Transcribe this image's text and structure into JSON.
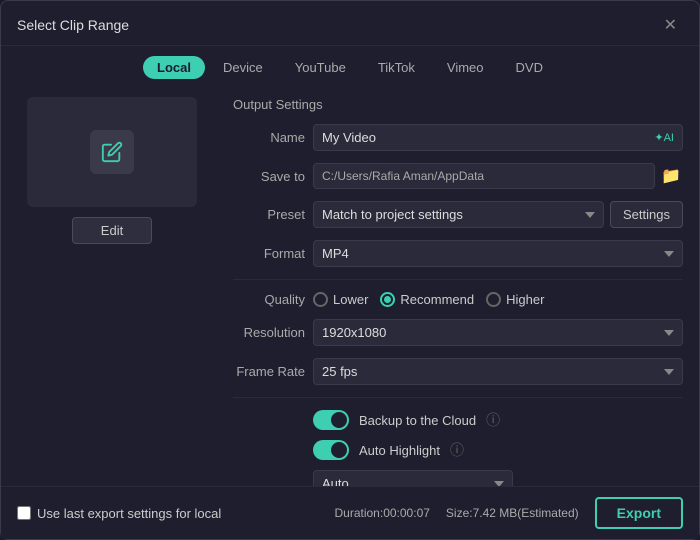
{
  "dialog": {
    "title": "Select Clip Range",
    "close_label": "✕"
  },
  "tabs": [
    {
      "id": "local",
      "label": "Local",
      "active": true
    },
    {
      "id": "device",
      "label": "Device",
      "active": false
    },
    {
      "id": "youtube",
      "label": "YouTube",
      "active": false
    },
    {
      "id": "tiktok",
      "label": "TikTok",
      "active": false
    },
    {
      "id": "vimeo",
      "label": "Vimeo",
      "active": false
    },
    {
      "id": "dvd",
      "label": "DVD",
      "active": false
    }
  ],
  "left_panel": {
    "edit_label": "Edit"
  },
  "output_settings": {
    "section_title": "Output Settings",
    "name_label": "Name",
    "name_value": "My Video",
    "ai_label": "✦AI",
    "save_to_label": "Save to",
    "save_to_path": "C:/Users/Rafia Aman/AppData",
    "preset_label": "Preset",
    "preset_value": "Match to project settings",
    "settings_btn": "Settings",
    "format_label": "Format",
    "format_value": "MP4",
    "quality_label": "Quality",
    "quality_options": [
      {
        "id": "lower",
        "label": "Lower",
        "checked": false
      },
      {
        "id": "recommend",
        "label": "Recommend",
        "checked": true
      },
      {
        "id": "higher",
        "label": "Higher",
        "checked": false
      }
    ],
    "resolution_label": "Resolution",
    "resolution_value": "1920x1080",
    "frame_rate_label": "Frame Rate",
    "frame_rate_value": "25 fps",
    "backup_cloud_label": "Backup to the Cloud",
    "auto_highlight_label": "Auto Highlight",
    "auto_select_value": "Auto"
  },
  "footer": {
    "checkbox_label": "Use last export settings for local",
    "duration_label": "Duration:",
    "duration_value": "00:00:07",
    "size_label": "Size:",
    "size_value": "7.42 MB(Estimated)",
    "export_label": "Export"
  }
}
